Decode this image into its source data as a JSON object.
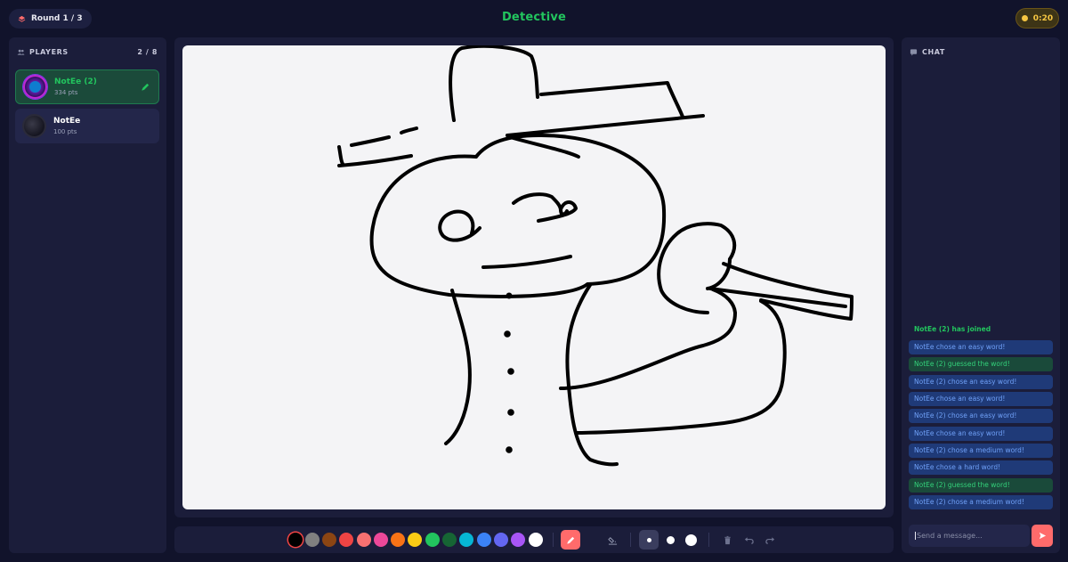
{
  "header": {
    "round_label": "Round 1 / 3",
    "word": "Detective",
    "timer": "0:20"
  },
  "players": {
    "title": "PLAYERS",
    "count": "2 / 8",
    "list": [
      {
        "name": "NotEe (2)",
        "points": "334 pts",
        "drawing": true
      },
      {
        "name": "NotEe",
        "points": "100 pts",
        "drawing": false
      }
    ]
  },
  "toolbar": {
    "colors": [
      "#000000",
      "#808080",
      "#8b4513",
      "#ef4444",
      "#f87171",
      "#ec4899",
      "#f97316",
      "#facc15",
      "#22c55e",
      "#166534",
      "#06b6d4",
      "#3b82f6",
      "#6366f1",
      "#a855f7",
      "#ffffff"
    ],
    "selected_color": "#000000",
    "tools": [
      "pencil-icon",
      "fill-bucket-icon"
    ],
    "brush_sizes": [
      "small",
      "medium",
      "large"
    ],
    "selected_size": "small",
    "actions": [
      "trash-icon",
      "undo-icon",
      "redo-icon"
    ]
  },
  "chat": {
    "title": "CHAT",
    "messages": [
      {
        "text": "NotEe (2) has joined",
        "kind": "joined"
      },
      {
        "text": "NotEe chose an easy word!",
        "kind": "blue"
      },
      {
        "text": "NotEe (2) guessed the word!",
        "kind": "green"
      },
      {
        "text": "NotEe (2) chose an easy word!",
        "kind": "blue"
      },
      {
        "text": "NotEe chose an easy word!",
        "kind": "blue"
      },
      {
        "text": "NotEe (2) chose an easy word!",
        "kind": "blue"
      },
      {
        "text": "NotEe chose an easy word!",
        "kind": "blue"
      },
      {
        "text": "NotEe (2) chose a medium word!",
        "kind": "blue"
      },
      {
        "text": "NotEe chose a hard word!",
        "kind": "blue"
      },
      {
        "text": "NotEe (2) guessed the word!",
        "kind": "green"
      },
      {
        "text": "NotEe (2) chose a medium word!",
        "kind": "blue"
      }
    ],
    "input_placeholder": "Send a message..."
  },
  "colors": {
    "background": "#11132b",
    "panel": "#1b1d3a",
    "accent_green": "#22c55e",
    "accent_red": "#ff6b6b",
    "timer_yellow": "#f5c542"
  }
}
